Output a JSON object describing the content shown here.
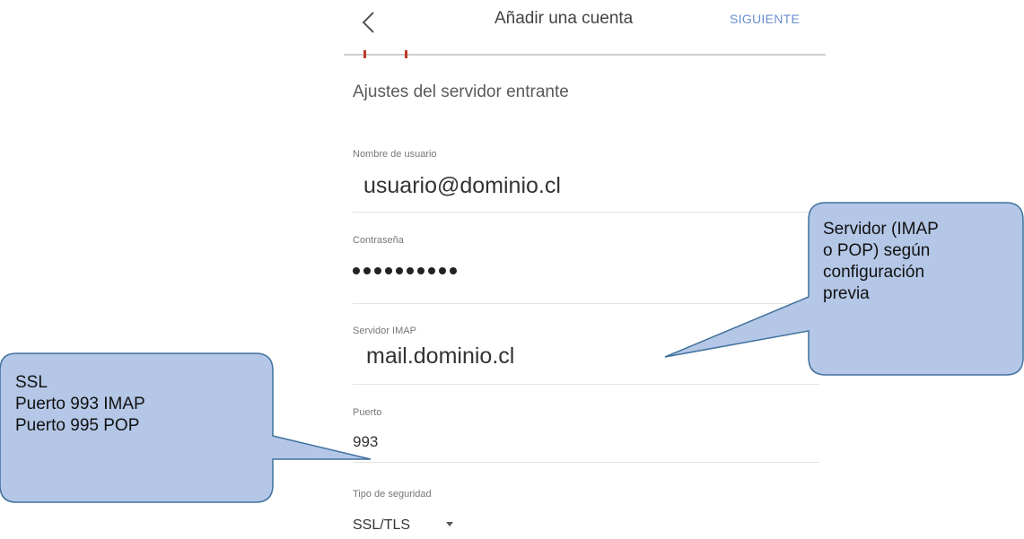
{
  "appbar": {
    "title": "Añadir una cuenta",
    "next_label": "SIGUIENTE"
  },
  "section_title": "Ajustes del servidor entrante",
  "fields": {
    "username": {
      "label": "Nombre de usuario",
      "value": "usuario@dominio.cl"
    },
    "password": {
      "label": "Contraseña",
      "masked_length": 10
    },
    "server": {
      "label": "Servidor IMAP",
      "value": "mail.dominio.cl"
    },
    "port": {
      "label": "Puerto",
      "value": "993"
    },
    "security": {
      "label": "Tipo de seguridad",
      "value": "SSL/TLS"
    }
  },
  "callouts": {
    "server_note": [
      "Servidor (IMAP",
      "o POP) según",
      "configuración",
      "previa"
    ],
    "ssl_note": [
      "SSL",
      "Puerto 993 IMAP",
      "Puerto 995 POP"
    ]
  },
  "colors": {
    "accent": "#6a8fd0",
    "progress_mark": "#c0392b",
    "callout_fill": "#b4c7e7",
    "callout_stroke": "#41719c"
  },
  "icons": {
    "back": "chevron-left-icon",
    "dropdown": "caret-down-icon"
  }
}
